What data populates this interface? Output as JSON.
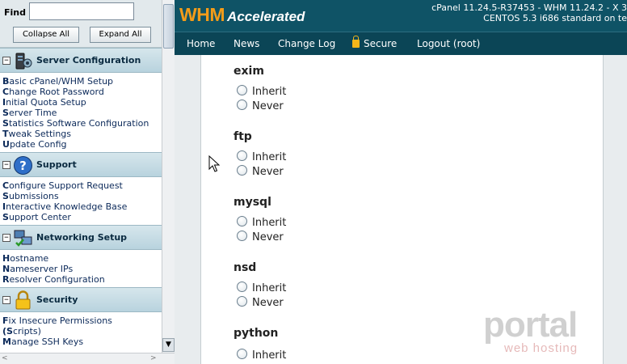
{
  "sidebar": {
    "find_label": "Find",
    "find_value": "",
    "collapse_label": "Collapse All",
    "expand_label": "Expand All",
    "sections": [
      {
        "title": "Server Configuration",
        "icon": "server-icon",
        "items": [
          "Basic cPanel/WHM Setup",
          "Change Root Password",
          "Initial Quota Setup",
          "Server Time",
          "Statistics Software Configuration",
          "Tweak Settings",
          "Update Config"
        ]
      },
      {
        "title": "Support",
        "icon": "question-icon",
        "items": [
          "Configure Support Request",
          "Submissions",
          "Interactive Knowledge Base",
          "Support Center"
        ]
      },
      {
        "title": "Networking Setup",
        "icon": "network-icon",
        "items": [
          "Hostname",
          "Nameserver IPs",
          "Resolver Configuration"
        ]
      },
      {
        "title": "Security",
        "icon": "padlock-icon",
        "items": [
          "Fix Insecure Permissions",
          "(Scripts)",
          "Manage SSH Keys"
        ]
      }
    ]
  },
  "header": {
    "logo_part1": "WHM",
    "logo_part2": "Accelerated",
    "version_line1": "cPanel 11.24.5-R37453 - WHM 11.24.2 - X 3",
    "version_line2": "CENTOS 5.3 i686 standard on te"
  },
  "nav": {
    "home": "Home",
    "news": "News",
    "changelog": "Change Log",
    "secure": "Secure",
    "logout": "Logout (root)"
  },
  "groups": [
    {
      "title": "exim",
      "options": [
        "Inherit",
        "Never"
      ]
    },
    {
      "title": "ftp",
      "options": [
        "Inherit",
        "Never"
      ]
    },
    {
      "title": "mysql",
      "options": [
        "Inherit",
        "Never"
      ]
    },
    {
      "title": "nsd",
      "options": [
        "Inherit",
        "Never"
      ]
    },
    {
      "title": "python",
      "options": [
        "Inherit"
      ]
    }
  ],
  "watermark": {
    "line1": "portal",
    "line2": "web hosting"
  }
}
